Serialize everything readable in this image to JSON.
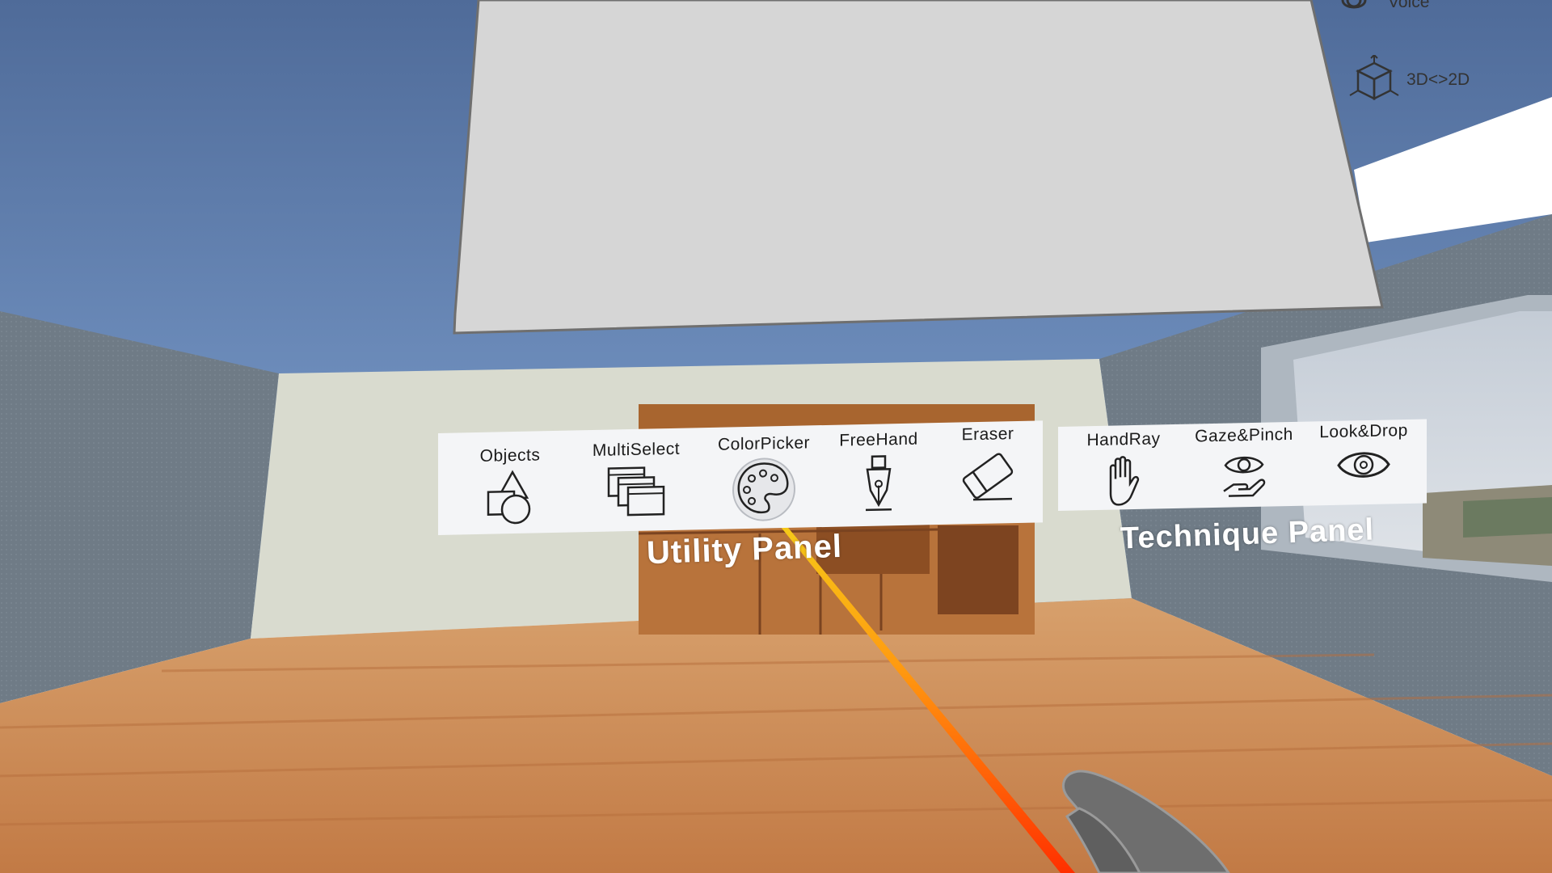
{
  "utility_panel": {
    "title": "Utility Panel",
    "tools": [
      {
        "label": "Objects",
        "icon": "shapes-icon"
      },
      {
        "label": "MultiSelect",
        "icon": "stacked-windows-icon"
      },
      {
        "label": "ColorPicker",
        "icon": "palette-icon",
        "state": "hovered"
      },
      {
        "label": "FreeHand",
        "icon": "pen-nib-icon"
      },
      {
        "label": "Eraser",
        "icon": "eraser-icon"
      }
    ]
  },
  "technique_panel": {
    "title": "Technique Panel",
    "tools": [
      {
        "label": "HandRay",
        "icon": "hand-icon"
      },
      {
        "label": "Gaze&Pinch",
        "icon": "eye-hand-icon"
      },
      {
        "label": "Look&Drop",
        "icon": "eye-icon"
      }
    ]
  },
  "side_menu": {
    "items": [
      {
        "label": "Voice",
        "icon": "microphone-icon"
      },
      {
        "label": "3D<>2D",
        "icon": "cube-icon"
      }
    ]
  },
  "colors": {
    "sky": "#5b7aa8",
    "wall_left": "#6e7a86",
    "back_wall": "#d7d9cf",
    "floor": "#c98752",
    "panel_bg": "#f4f5f7",
    "ray_start": "#f3c91a",
    "ray_end": "#ff3a00"
  }
}
